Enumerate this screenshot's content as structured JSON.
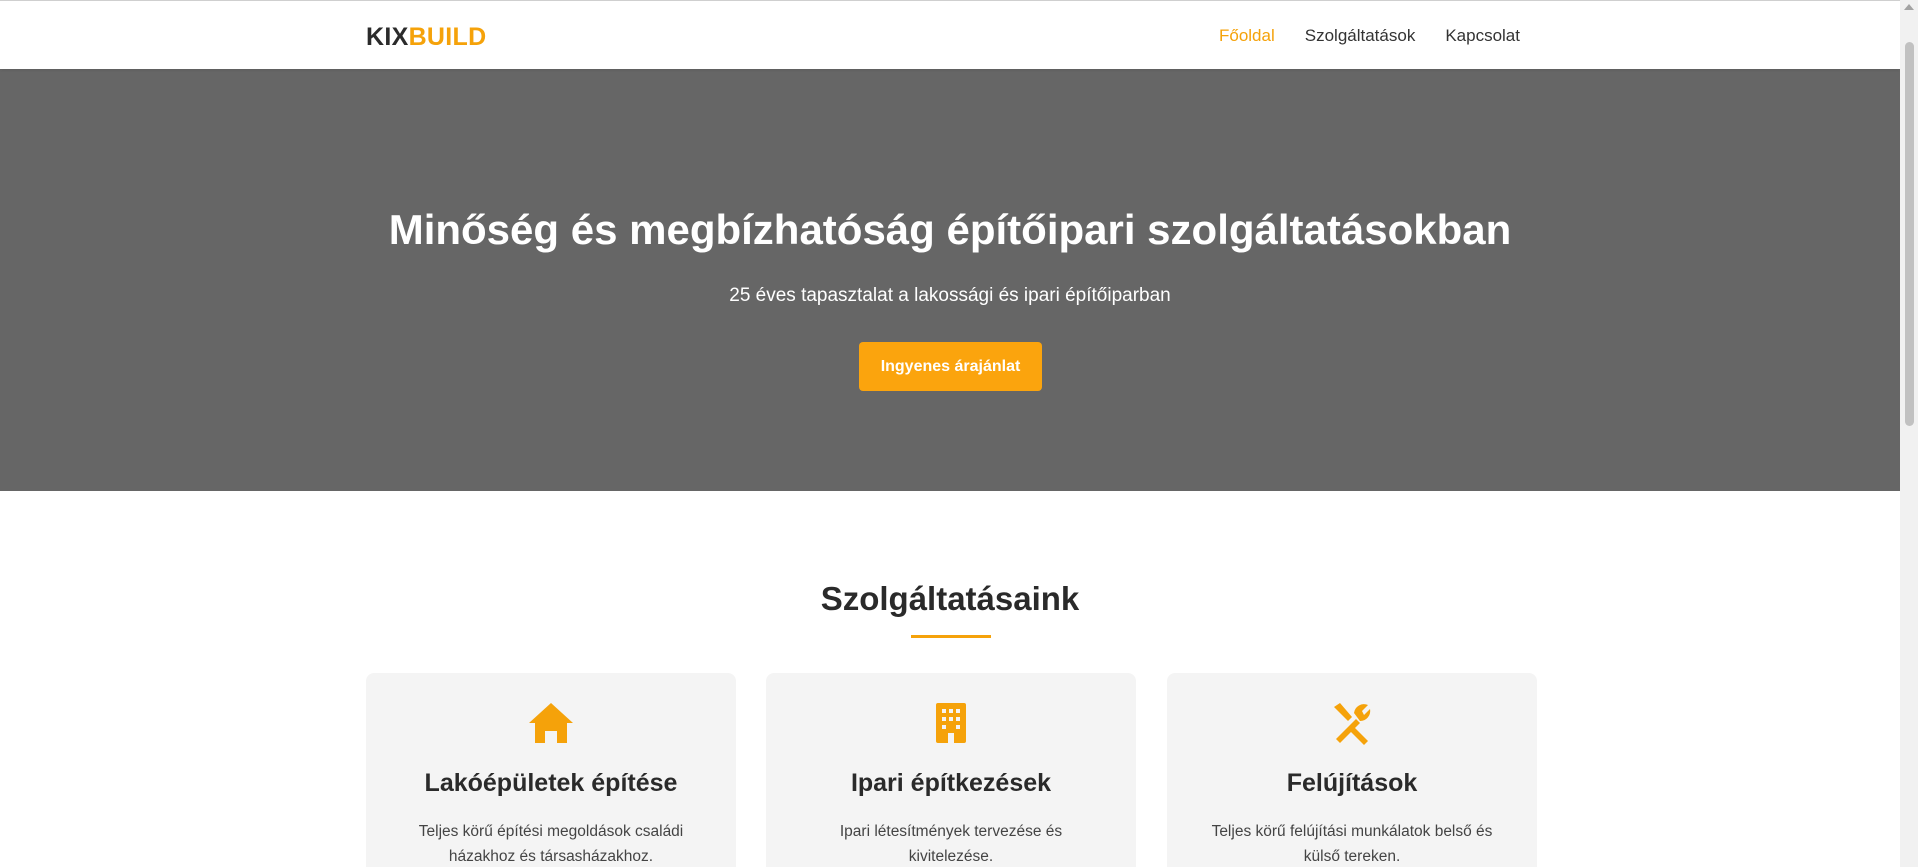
{
  "header": {
    "logo_part1": "KIX",
    "logo_part2": "BUILD",
    "nav": [
      {
        "label": "Főoldal",
        "active": true
      },
      {
        "label": "Szolgáltatások",
        "active": false
      },
      {
        "label": "Kapcsolat",
        "active": false
      }
    ]
  },
  "hero": {
    "title": "Minőség és megbízhatóság építőipari szolgáltatásokban",
    "subtitle": "25 éves tapasztalat a lakossági és ipari építőiparban",
    "cta_label": "Ingyenes árajánlat"
  },
  "services": {
    "title": "Szolgáltatásaink",
    "cards": [
      {
        "icon": "house-icon",
        "title": "Lakóépületek építése",
        "description": "Teljes körű építési megoldások családi házakhoz és társasházakhoz."
      },
      {
        "icon": "building-icon",
        "title": "Ipari építkezések",
        "description": "Ipari létesítmények tervezése és kivitelezése."
      },
      {
        "icon": "tools-icon",
        "title": "Felújítások",
        "description": "Teljes körű felújítási munkálatok belső és külső tereken."
      }
    ]
  },
  "colors": {
    "accent": "#f5a20a",
    "hero_bg": "#666666",
    "card_bg": "#f4f4f4"
  }
}
